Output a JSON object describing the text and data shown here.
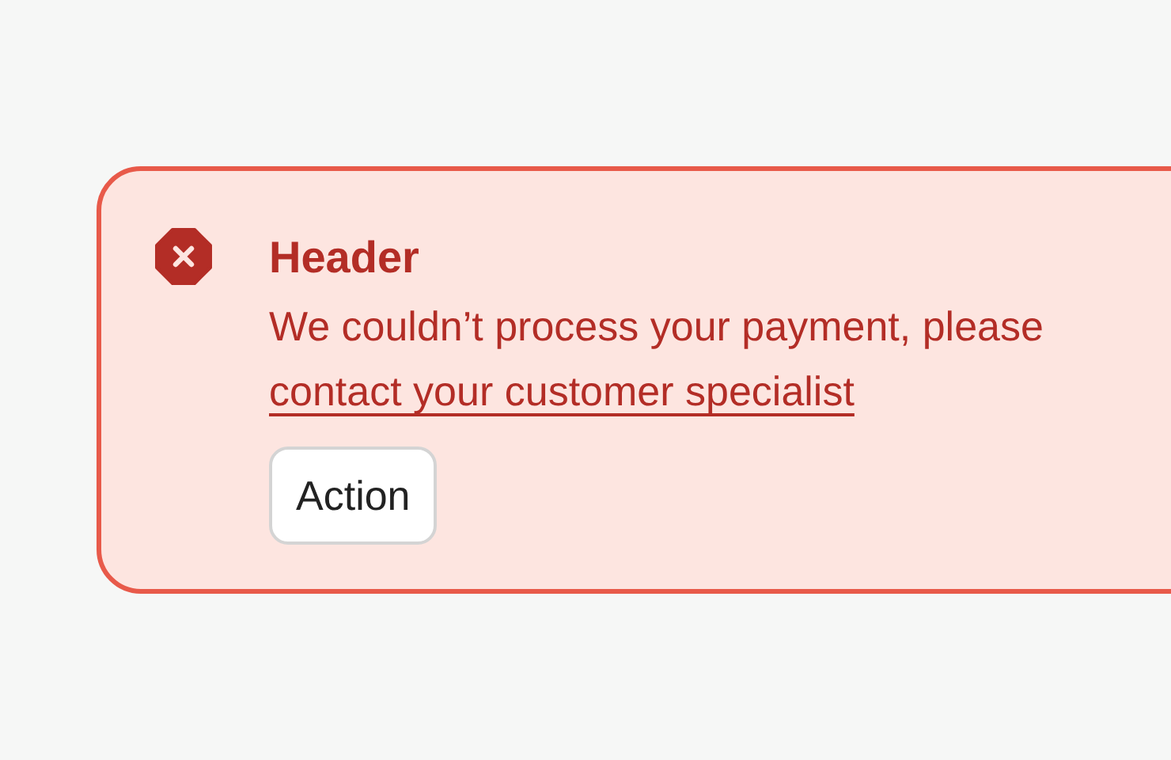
{
  "banner": {
    "kind": "error",
    "header": "Header",
    "message": "We couldn’t process your payment, please",
    "link": "contact your customer specialist",
    "action": "Action"
  }
}
